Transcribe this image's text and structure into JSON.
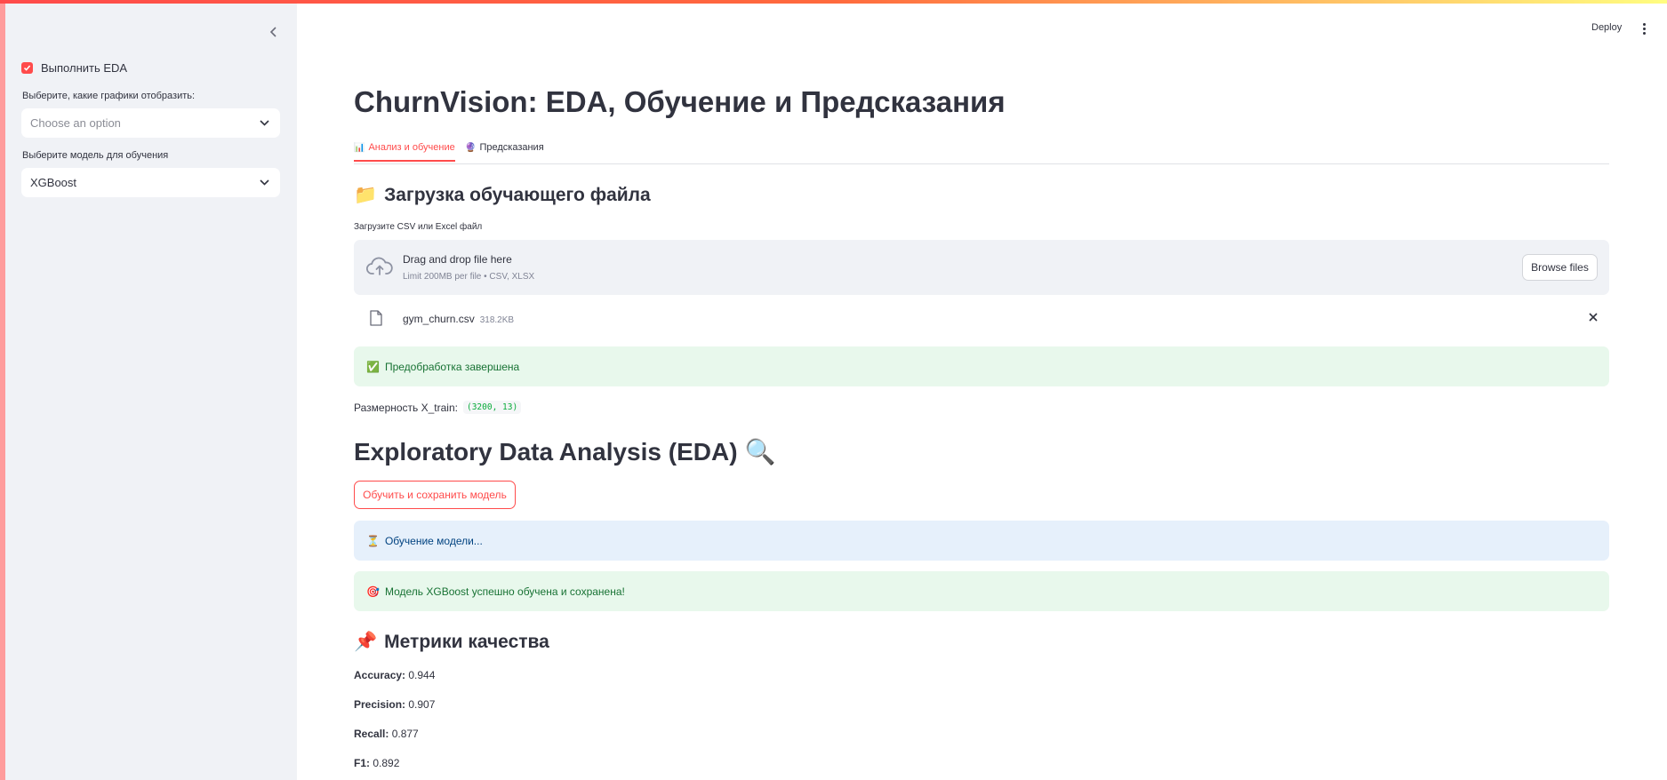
{
  "sidebar": {
    "eda_checkbox_label": "Выполнить EDA",
    "eda_checked": true,
    "charts_label": "Выберите, какие графики отобразить:",
    "charts_placeholder": "Choose an option",
    "model_label": "Выберите модель для обучения",
    "model_value": "XGBoost"
  },
  "header": {
    "deploy_label": "Deploy"
  },
  "main": {
    "title": "ChurnVision: EDA, Обучение и Предсказания",
    "tabs": [
      {
        "icon": "📊",
        "label": "Анализ и обучение",
        "active": true
      },
      {
        "icon": "🔮",
        "label": "Предсказания",
        "active": false
      }
    ],
    "upload_heading": "Загрузка обучающего файла",
    "upload_heading_icon": "📁",
    "upload_caption": "Загрузите CSV или Excel файл",
    "dropzone_title": "Drag and drop file here",
    "dropzone_sub": "Limit 200MB per file • CSV, XLSX",
    "browse_label": "Browse files",
    "file_name": "gym_churn.csv",
    "file_size": "318.2KB",
    "preprocess_icon": "✅",
    "preprocess_msg": "Предобработка завершена",
    "shape_label": "Размерность X_train:",
    "shape_value": "(3200, 13)",
    "eda_heading": "Exploratory Data Analysis (EDA)",
    "eda_icon": "🔍",
    "train_button": "Обучить и сохранить модель",
    "training_icon": "⏳",
    "training_msg": "Обучение модели...",
    "trained_icon": "🎯",
    "trained_msg": "Модель XGBoost успешно обучена и сохранена!",
    "metrics_heading": "Метрики качества",
    "metrics_icon": "📌",
    "metrics": [
      {
        "name": "Accuracy:",
        "value": "0.944"
      },
      {
        "name": "Precision:",
        "value": "0.907"
      },
      {
        "name": "Recall:",
        "value": "0.877"
      },
      {
        "name": "F1:",
        "value": "0.892"
      }
    ]
  },
  "colors": {
    "accent": "#ff4b4b",
    "sidebar_bg": "#f0f2f6",
    "success_bg": "#e8f8ec",
    "info_bg": "#e6f0fb"
  },
  "icons": [
    "chevron-left-icon",
    "check-icon",
    "chevron-down-icon",
    "cloud-upload-icon",
    "file-icon",
    "close-icon",
    "kebab-menu-icon"
  ]
}
